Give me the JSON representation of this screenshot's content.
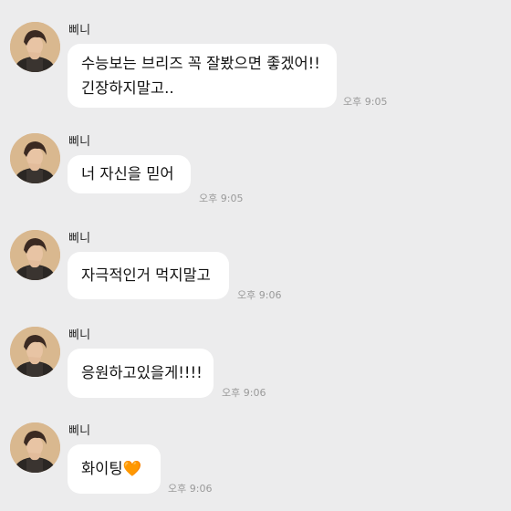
{
  "chat": {
    "messages": [
      {
        "sender": "삐니",
        "lines": [
          "수능보는 브리즈 꼭 잘봤으면 좋겠어!!",
          "긴장하지말고.."
        ],
        "time": "오후 9:05"
      },
      {
        "sender": "삐니",
        "lines": [
          "너 자신을 믿어"
        ],
        "time": "오후 9:05"
      },
      {
        "sender": "삐니",
        "lines": [
          "자극적인거 먹지말고"
        ],
        "time": "오후 9:06"
      },
      {
        "sender": "삐니",
        "lines": [
          "응원하고있을게!!!!"
        ],
        "time": "오후 9:06"
      },
      {
        "sender": "삐니",
        "lines": [
          "화이팅🧡"
        ],
        "time": "오후 9:06"
      }
    ]
  }
}
